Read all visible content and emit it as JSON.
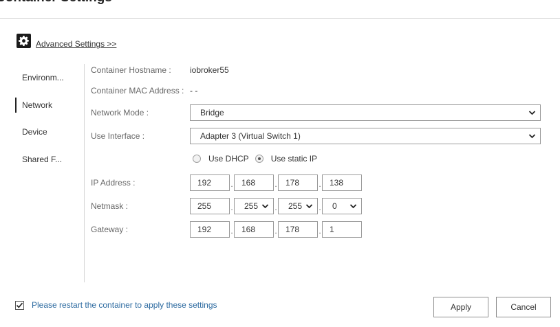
{
  "dialog": {
    "title": "Container Settings"
  },
  "advanced": {
    "label": "Advanced Settings >>",
    "icon": "gear-icon"
  },
  "sidebar": {
    "items": [
      {
        "label": "Environm..."
      },
      {
        "label": "Network"
      },
      {
        "label": "Device"
      },
      {
        "label": "Shared F..."
      }
    ],
    "active": "Network"
  },
  "network": {
    "hostname_label": "Container Hostname :",
    "hostname_value": "iobroker55",
    "mac_label": "Container MAC Address :",
    "mac_value": "- -",
    "mode_label": "Network Mode :",
    "mode_value": "Bridge",
    "interface_label": "Use Interface :",
    "interface_value": "Adapter 3 (Virtual Switch 1)",
    "dhcp_label": "Use DHCP",
    "static_label": "Use static IP",
    "ip_mode_selected": "Use static IP",
    "ip_label": "IP Address :",
    "ip": [
      "192",
      "168",
      "178",
      "138"
    ],
    "netmask_label": "Netmask :",
    "netmask": [
      "255",
      "255",
      "255",
      "0"
    ],
    "gateway_label": "Gateway :",
    "gateway": [
      "192",
      "168",
      "178",
      "1"
    ]
  },
  "footer": {
    "restart_checked": true,
    "restart_text": "Please restart the container to apply these settings",
    "apply_label": "Apply",
    "cancel_label": "Cancel"
  }
}
